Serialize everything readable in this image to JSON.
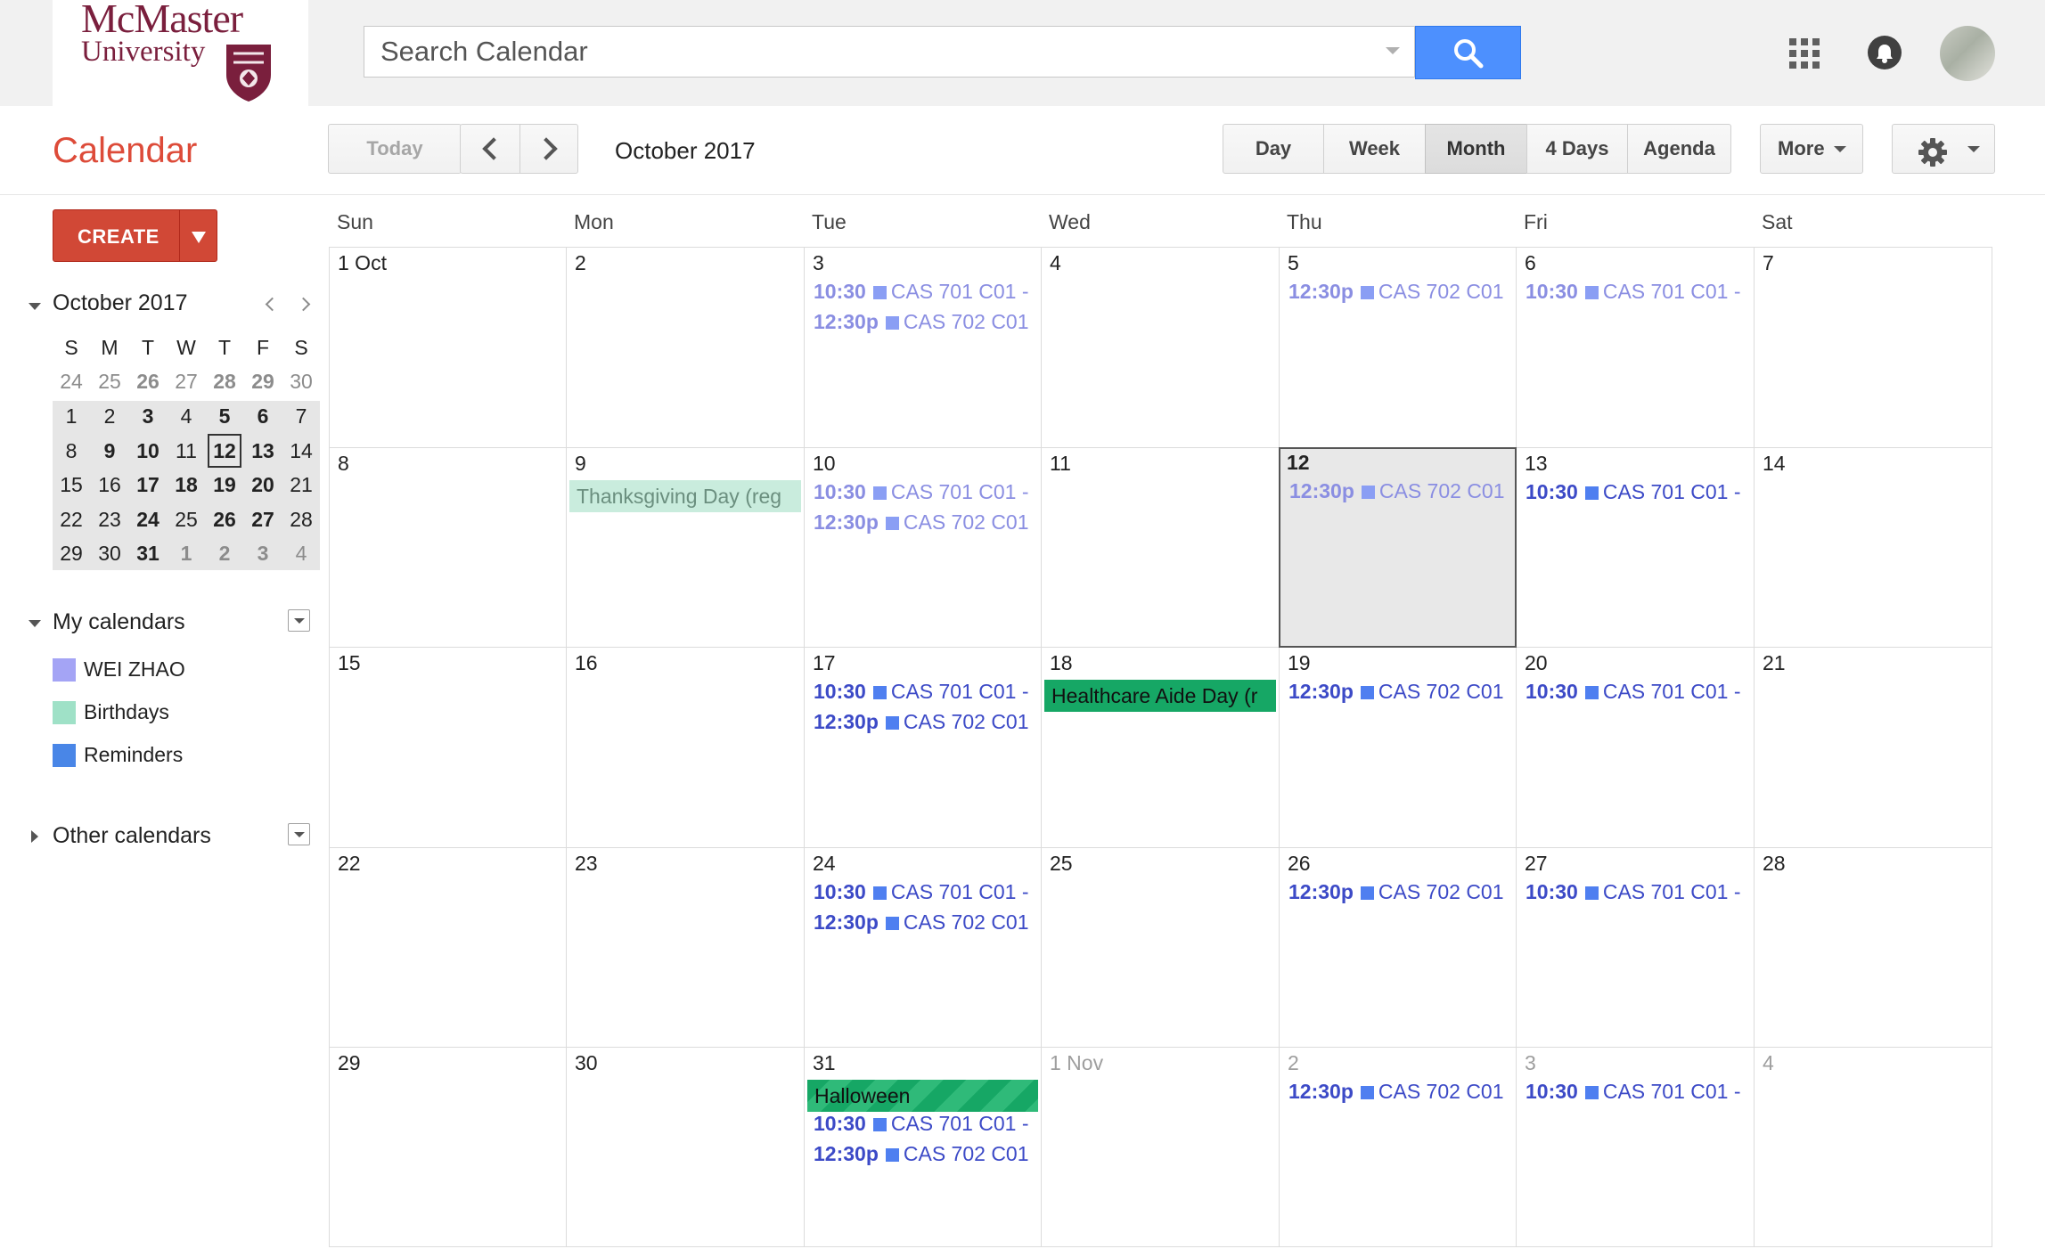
{
  "logo": {
    "line1": "McMaster",
    "line2": "University"
  },
  "search": {
    "placeholder": "Search Calendar"
  },
  "app_title": "Calendar",
  "toolbar": {
    "today": "Today",
    "current_period": "October 2017",
    "views": [
      "Day",
      "Week",
      "Month",
      "4 Days",
      "Agenda"
    ],
    "active_view": "Month",
    "more": "More"
  },
  "sidebar": {
    "create": "CREATE",
    "mini_calendar": {
      "title": "October 2017",
      "weekday_headers": [
        "S",
        "M",
        "T",
        "W",
        "T",
        "F",
        "S"
      ],
      "weeks": [
        [
          "24",
          "25",
          "26",
          "27",
          "28",
          "29",
          "30"
        ],
        [
          "1",
          "2",
          "3",
          "4",
          "5",
          "6",
          "7"
        ],
        [
          "8",
          "9",
          "10",
          "11",
          "12",
          "13",
          "14"
        ],
        [
          "15",
          "16",
          "17",
          "18",
          "19",
          "20",
          "21"
        ],
        [
          "22",
          "23",
          "24",
          "25",
          "26",
          "27",
          "28"
        ],
        [
          "29",
          "30",
          "31",
          "1",
          "2",
          "3",
          "4"
        ]
      ],
      "today": "12"
    },
    "my_calendars": {
      "title": "My calendars",
      "items": [
        {
          "name": "WEI ZHAO",
          "color": "#a4a4f5"
        },
        {
          "name": "Birthdays",
          "color": "#9fe1c7"
        },
        {
          "name": "Reminders",
          "color": "#4986e7"
        }
      ]
    },
    "other_calendars": {
      "title": "Other calendars"
    }
  },
  "month": {
    "weekdays": [
      "Sun",
      "Mon",
      "Tue",
      "Wed",
      "Thu",
      "Fri",
      "Sat"
    ],
    "events": {
      "tue": {
        "time": "10:30",
        "title": "CAS 701 C01 -"
      },
      "thu_tue": {
        "time": "12:30p",
        "title": "CAS 702 C01"
      },
      "fri": {
        "time": "10:30",
        "title": "CAS 701 C01 -"
      }
    },
    "weeks": [
      {
        "days": [
          {
            "label": "1 Oct"
          },
          {
            "label": "2"
          },
          {
            "label": "3"
          },
          {
            "label": "4"
          },
          {
            "label": "5"
          },
          {
            "label": "6"
          },
          {
            "label": "7"
          }
        ]
      },
      {
        "days": [
          {
            "label": "8"
          },
          {
            "label": "9",
            "allday": "Thanksgiving Day (reg"
          },
          {
            "label": "10"
          },
          {
            "label": "11"
          },
          {
            "label": "12"
          },
          {
            "label": "13"
          },
          {
            "label": "14"
          }
        ]
      },
      {
        "days": [
          {
            "label": "15"
          },
          {
            "label": "16"
          },
          {
            "label": "17"
          },
          {
            "label": "18",
            "allday": "Healthcare Aide Day (r"
          },
          {
            "label": "19"
          },
          {
            "label": "20"
          },
          {
            "label": "21"
          }
        ]
      },
      {
        "days": [
          {
            "label": "22"
          },
          {
            "label": "23"
          },
          {
            "label": "24"
          },
          {
            "label": "25"
          },
          {
            "label": "26"
          },
          {
            "label": "27"
          },
          {
            "label": "28"
          }
        ]
      },
      {
        "days": [
          {
            "label": "29"
          },
          {
            "label": "30"
          },
          {
            "label": "31",
            "allday": "Halloween"
          },
          {
            "label": "1 Nov"
          },
          {
            "label": "2"
          },
          {
            "label": "3"
          },
          {
            "label": "4"
          }
        ]
      }
    ]
  },
  "colors": {
    "brand": "#7a1f3d",
    "create": "#d14836",
    "search_button": "#4d90fe",
    "event_text": "#3c4ac7",
    "past_event_text": "#8a8ee2",
    "holiday_green": "#16a765"
  }
}
